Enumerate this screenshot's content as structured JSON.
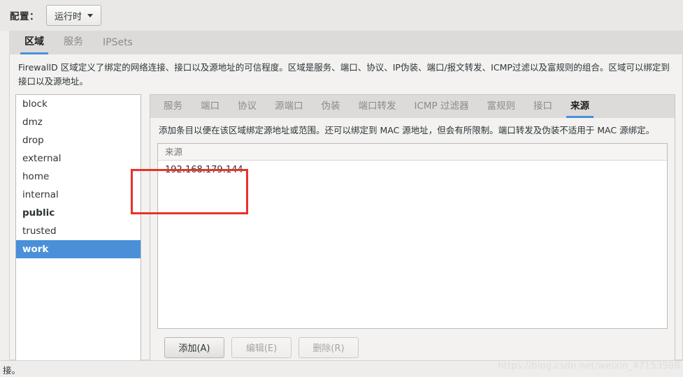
{
  "config_bar": {
    "label": "配置：",
    "dropdown_value": "运行时",
    "caret_icon": "chevron-down-icon"
  },
  "main_tabs": [
    {
      "label": "区域",
      "active": true
    },
    {
      "label": "服务",
      "active": false
    },
    {
      "label": "IPSets",
      "active": false
    }
  ],
  "zone_description": "FirewallD 区域定义了绑定的网络连接、接口以及源地址的可信程度。区域是服务、端口、协议、IP伪装、端口/报文转发、ICMP过滤以及富规则的组合。区域可以绑定到接口以及源地址。",
  "zone_list": [
    {
      "label": "block",
      "state": "normal"
    },
    {
      "label": "dmz",
      "state": "normal"
    },
    {
      "label": "drop",
      "state": "normal"
    },
    {
      "label": "external",
      "state": "normal"
    },
    {
      "label": "home",
      "state": "normal"
    },
    {
      "label": "internal",
      "state": "normal"
    },
    {
      "label": "public",
      "state": "default"
    },
    {
      "label": "trusted",
      "state": "normal"
    },
    {
      "label": "work",
      "state": "selected"
    }
  ],
  "inner_tabs": [
    {
      "label": "服务",
      "active": false
    },
    {
      "label": "端口",
      "active": false
    },
    {
      "label": "协议",
      "active": false
    },
    {
      "label": "源端口",
      "active": false
    },
    {
      "label": "伪装",
      "active": false
    },
    {
      "label": "端口转发",
      "active": false
    },
    {
      "label": "ICMP 过滤器",
      "active": false
    },
    {
      "label": "富规则",
      "active": false
    },
    {
      "label": "接口",
      "active": false
    },
    {
      "label": "来源",
      "active": true
    }
  ],
  "panel_description": "添加条目以便在该区域绑定源地址或范围。还可以绑定到 MAC 源地址，但会有所限制。端口转发及伪装不适用于 MAC 源绑定。",
  "table": {
    "column_header": "来源",
    "rows": [
      {
        "source": "192.168.179.144"
      }
    ]
  },
  "buttons": [
    {
      "label": "添加(A)",
      "enabled": true
    },
    {
      "label": "编辑(E)",
      "enabled": false
    },
    {
      "label": "删除(R)",
      "enabled": false
    }
  ],
  "statusbar": {
    "text": "接。",
    "watermark": "https://blog.csdn.net/weixin_47153988"
  },
  "colors": {
    "accent": "#4a90d9",
    "annotation": "#e8322a",
    "window_bg": "#f0efee"
  }
}
